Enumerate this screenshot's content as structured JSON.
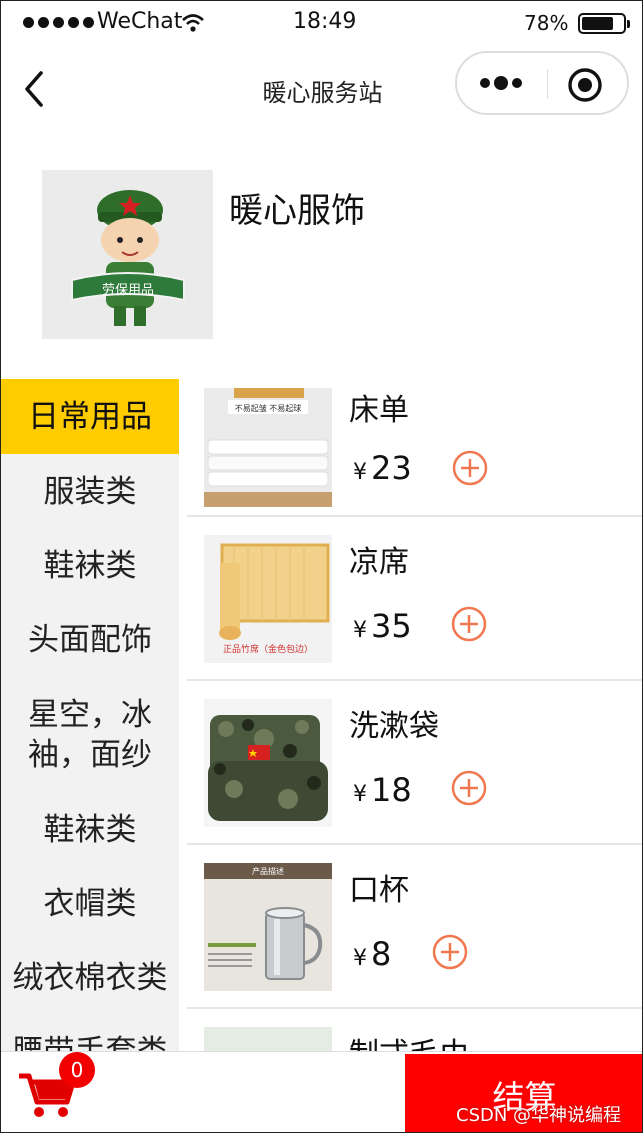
{
  "status_bar": {
    "carrier": "WeChat",
    "time": "18:49",
    "battery_percent": "78%",
    "battery_level": 0.78
  },
  "nav": {
    "title": "暖心服务站",
    "back_icon": "chevron-left-icon",
    "more_icon": "more-dots-icon",
    "close_icon": "target-circle-icon"
  },
  "shop": {
    "name": "暖心服饰",
    "logo_caption": "劳保用品"
  },
  "categories": [
    {
      "label": "日常用品",
      "active": true
    },
    {
      "label": "服装类",
      "active": false
    },
    {
      "label": "鞋袜类",
      "active": false
    },
    {
      "label": "头面配饰",
      "active": false
    },
    {
      "label": "星空，冰袖，面纱",
      "active": false
    },
    {
      "label": "鞋袜类",
      "active": false
    },
    {
      "label": "衣帽类",
      "active": false
    },
    {
      "label": "绒衣棉衣类",
      "active": false
    },
    {
      "label": "腰带手套类",
      "active": false
    }
  ],
  "products": [
    {
      "name": "床单",
      "currency": "¥",
      "price": "23",
      "image_caption": "不易起皱 不易起球"
    },
    {
      "name": "凉席",
      "currency": "¥",
      "price": "35",
      "image_caption": "正品竹席（金色包边）"
    },
    {
      "name": "洗漱袋",
      "currency": "¥",
      "price": "18",
      "image_caption": ""
    },
    {
      "name": "口杯",
      "currency": "¥",
      "price": "8",
      "image_caption": "产品描述"
    },
    {
      "name": "制式毛巾",
      "currency": "¥",
      "price": "",
      "image_caption": ""
    }
  ],
  "cart": {
    "count": "0",
    "icon": "shopping-cart-icon"
  },
  "checkout": {
    "label": "结算"
  },
  "watermark": "CSDN @华神说编程",
  "colors": {
    "active_category": "#ffcc00",
    "checkout": "#ff0000",
    "add_icon": "#f07850",
    "cart": "#e00000",
    "sidebar_bg": "#f2f2f2"
  }
}
